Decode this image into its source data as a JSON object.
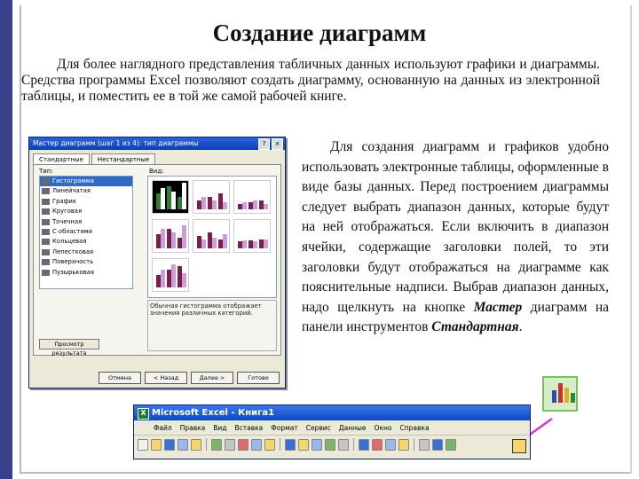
{
  "title": "Создание диаграмм",
  "intro": "Для более наглядного представления табличных данных используют графики и диаграммы. Средства программы Excel позволяют создать диаграмму, основанную на данных из электронной таблицы, и поместить ее в той же самой рабочей книге.",
  "right_text": {
    "part1": "Для создания диаграмм и графиков удобно использовать электронные таблицы, оформленные в виде базы данных. Перед построением диаграммы следует выбрать диапазон данных, которые будут на ней отображаться. Если включить в диапазон ячейки, содержащие заголовки полей, то эти заголовки будут отображаться на диаграмме как пояснительные надписи. Выбрав диапазон данных, надо щелкнуть на кнопке ",
    "em1": "Мастер",
    "part2": " диаграмм на панели инструментов ",
    "em2": "Стандартная",
    "part3": "."
  },
  "wizard": {
    "title": "Мастер диаграмм (шаг 1 из 4): тип диаграммы",
    "title_buttons": [
      "?",
      "×"
    ],
    "tabs": [
      "Стандартные",
      "Нестандартные"
    ],
    "type_label": "Тип:",
    "view_label": "Вид:",
    "types": [
      "Гистограмма",
      "Линейчатая",
      "График",
      "Круговая",
      "Точечная",
      "С областями",
      "Кольцевая",
      "Лепестковая",
      "Поверхность",
      "Пузырьковая"
    ],
    "selected_type": 0,
    "description": "Обычная гистограмма отображает значения различных категорий.",
    "preview_button": "Просмотр результата",
    "footer_buttons": [
      "Отмена",
      "< Назад",
      "Далее >",
      "Готово"
    ]
  },
  "excel": {
    "title": "Microsoft Excel - Книга1",
    "logo": "X",
    "menu": [
      "Файл",
      "Правка",
      "Вид",
      "Вставка",
      "Формат",
      "Сервис",
      "Данные",
      "Окно",
      "Справка"
    ]
  },
  "colors": {
    "accent": "#3a3f8a",
    "bar_dark": "#7a1f4a",
    "bar_light": "#c9a0dc",
    "arrow": "#d633d6"
  }
}
